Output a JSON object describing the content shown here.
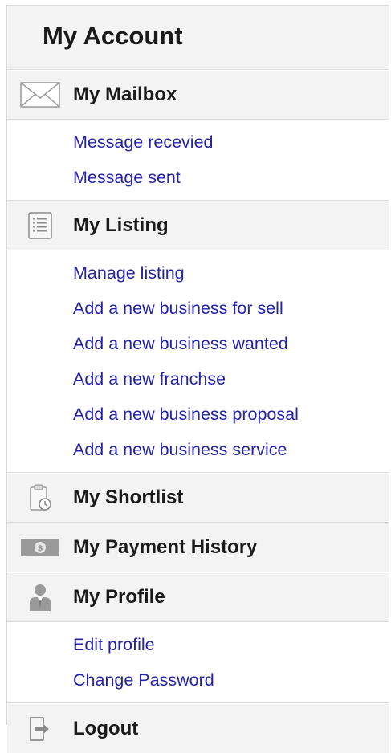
{
  "title": "My Account",
  "sections": [
    {
      "label": "My Mailbox",
      "icon": "envelope-icon",
      "items": [
        "Message recevied",
        "Message sent"
      ]
    },
    {
      "label": "My Listing",
      "icon": "list-icon",
      "items": [
        "Manage listing",
        "Add a new business for sell",
        "Add a new business wanted",
        "Add a new franchse",
        "Add a new business proposal",
        "Add a new business service"
      ]
    },
    {
      "label": "My Shortlist",
      "icon": "clipboard-icon",
      "items": []
    },
    {
      "label": "My Payment History",
      "icon": "money-icon",
      "items": []
    },
    {
      "label": "My Profile",
      "icon": "person-icon",
      "items": [
        "Edit profile",
        "Change Password"
      ]
    },
    {
      "label": "Logout",
      "icon": "logout-icon",
      "items": []
    }
  ],
  "colors": {
    "link": "#2222aa",
    "heading": "#1a1a1a",
    "panel_bg": "#f3f3f3"
  }
}
